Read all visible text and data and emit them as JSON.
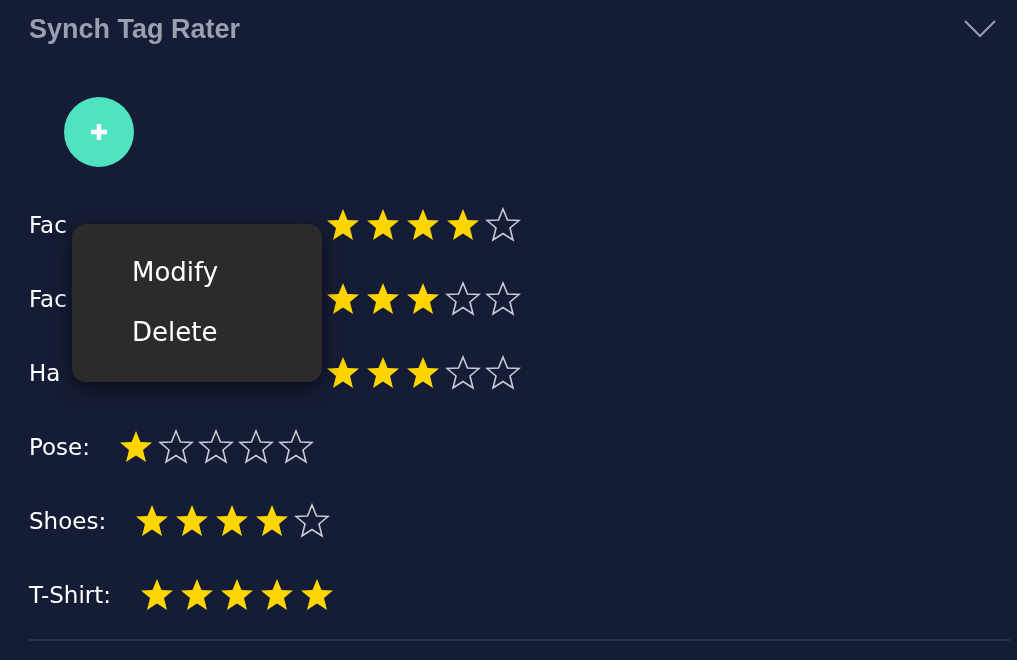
{
  "panel": {
    "title": "Synch Tag Rater",
    "expanded": true
  },
  "ratings": [
    {
      "label": "Fac",
      "stars": 4
    },
    {
      "label": "Fac",
      "stars": 3
    },
    {
      "label": "Ha",
      "stars": 3
    },
    {
      "label": "Pose:",
      "stars": 1
    },
    {
      "label": "Shoes:",
      "stars": 4
    },
    {
      "label": "T-Shirt:",
      "stars": 5
    }
  ],
  "context_menu": {
    "items": [
      "Modify",
      "Delete"
    ]
  }
}
